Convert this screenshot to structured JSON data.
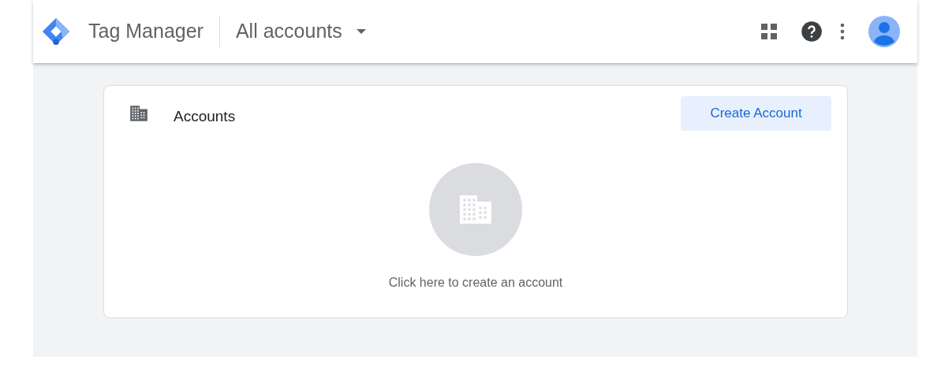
{
  "header": {
    "product": "Tag Manager",
    "account_selector": "All accounts"
  },
  "accounts_card": {
    "title": "Accounts",
    "create_button": "Create Account",
    "empty_hint": "Click here to create an account"
  }
}
